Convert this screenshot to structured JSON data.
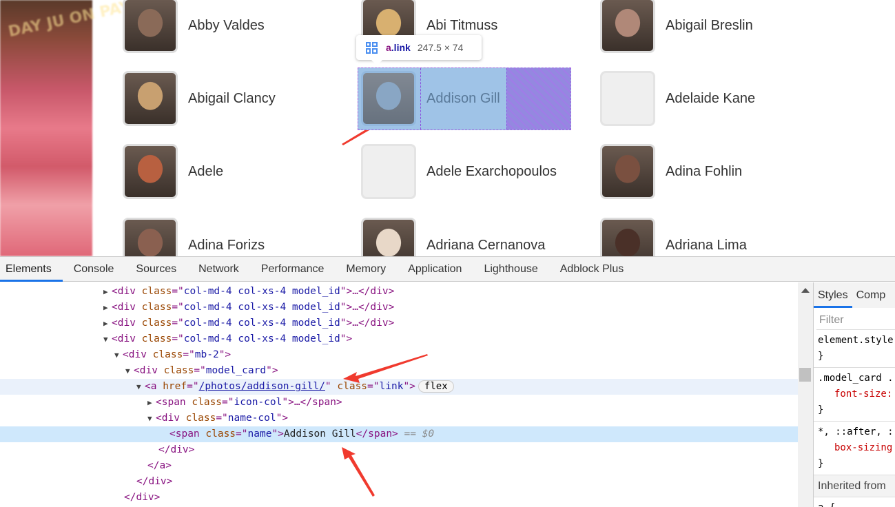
{
  "grid": {
    "cards": [
      {
        "name": "Abby Valdes",
        "photo": true,
        "tone": "#8a6a58"
      },
      {
        "name": "Abi Titmuss",
        "photo": true,
        "tone": "#d8b070"
      },
      {
        "name": "Abigail Breslin",
        "photo": true,
        "tone": "#b08878"
      },
      {
        "name": "Abigail Clancy",
        "photo": true,
        "tone": "#c8a070"
      },
      {
        "name": "Addison Gill",
        "photo": true,
        "tone": "#7890a8"
      },
      {
        "name": "Adelaide Kane",
        "photo": false
      },
      {
        "name": "Adele",
        "photo": true,
        "tone": "#b86040"
      },
      {
        "name": "Adele Exarchopoulos",
        "photo": false
      },
      {
        "name": "Adina Fohlin",
        "photo": true,
        "tone": "#7a5040"
      },
      {
        "name": "Adina Forizs",
        "photo": true,
        "tone": "#8a6050"
      },
      {
        "name": "Adriana Cernanova",
        "photo": true,
        "tone": "#e8d8c8"
      },
      {
        "name": "Adriana Lima",
        "photo": true,
        "tone": "#4a3028"
      }
    ]
  },
  "poster_text": "DAY JU ON PAY-PER",
  "inspect_tooltip": {
    "tag": "a",
    "cls": ".link",
    "dimensions": "247.5 × 74",
    "icon": "grid-layout-icon"
  },
  "devtools": {
    "tabs": [
      "Elements",
      "Console",
      "Sources",
      "Network",
      "Performance",
      "Memory",
      "Application",
      "Lighthouse",
      "Adblock Plus"
    ],
    "active_tab": "Elements",
    "tree": {
      "col_class": "col-md-4 col-xs-4 model_id",
      "mb_class": "mb-2",
      "card_class": "model_card",
      "href": "/photos/addison-gill/",
      "link_class": "link",
      "flex_badge": "flex",
      "icon_col_class": "icon-col",
      "name_col_class": "name-col",
      "name_class": "name",
      "name_text": "Addison Gill",
      "selected_marker": "== $0"
    },
    "styles": {
      "tabs": [
        "Styles",
        "Comp"
      ],
      "filter_placeholder": "Filter",
      "rules": [
        {
          "selector": "element.style {",
          "prop": ""
        },
        {
          "selector": ".model_card .",
          "prop": "font-size:"
        },
        {
          "selector": "*, ::after, :",
          "prop": "box-sizing"
        }
      ],
      "inherited": "Inherited from",
      "last_rule": "a {"
    }
  },
  "colors": {
    "highlight": "#9fc3e7",
    "padding": "#9488e0",
    "accent": "#1a73e8",
    "annotation_arrow": "#f03a2e"
  }
}
